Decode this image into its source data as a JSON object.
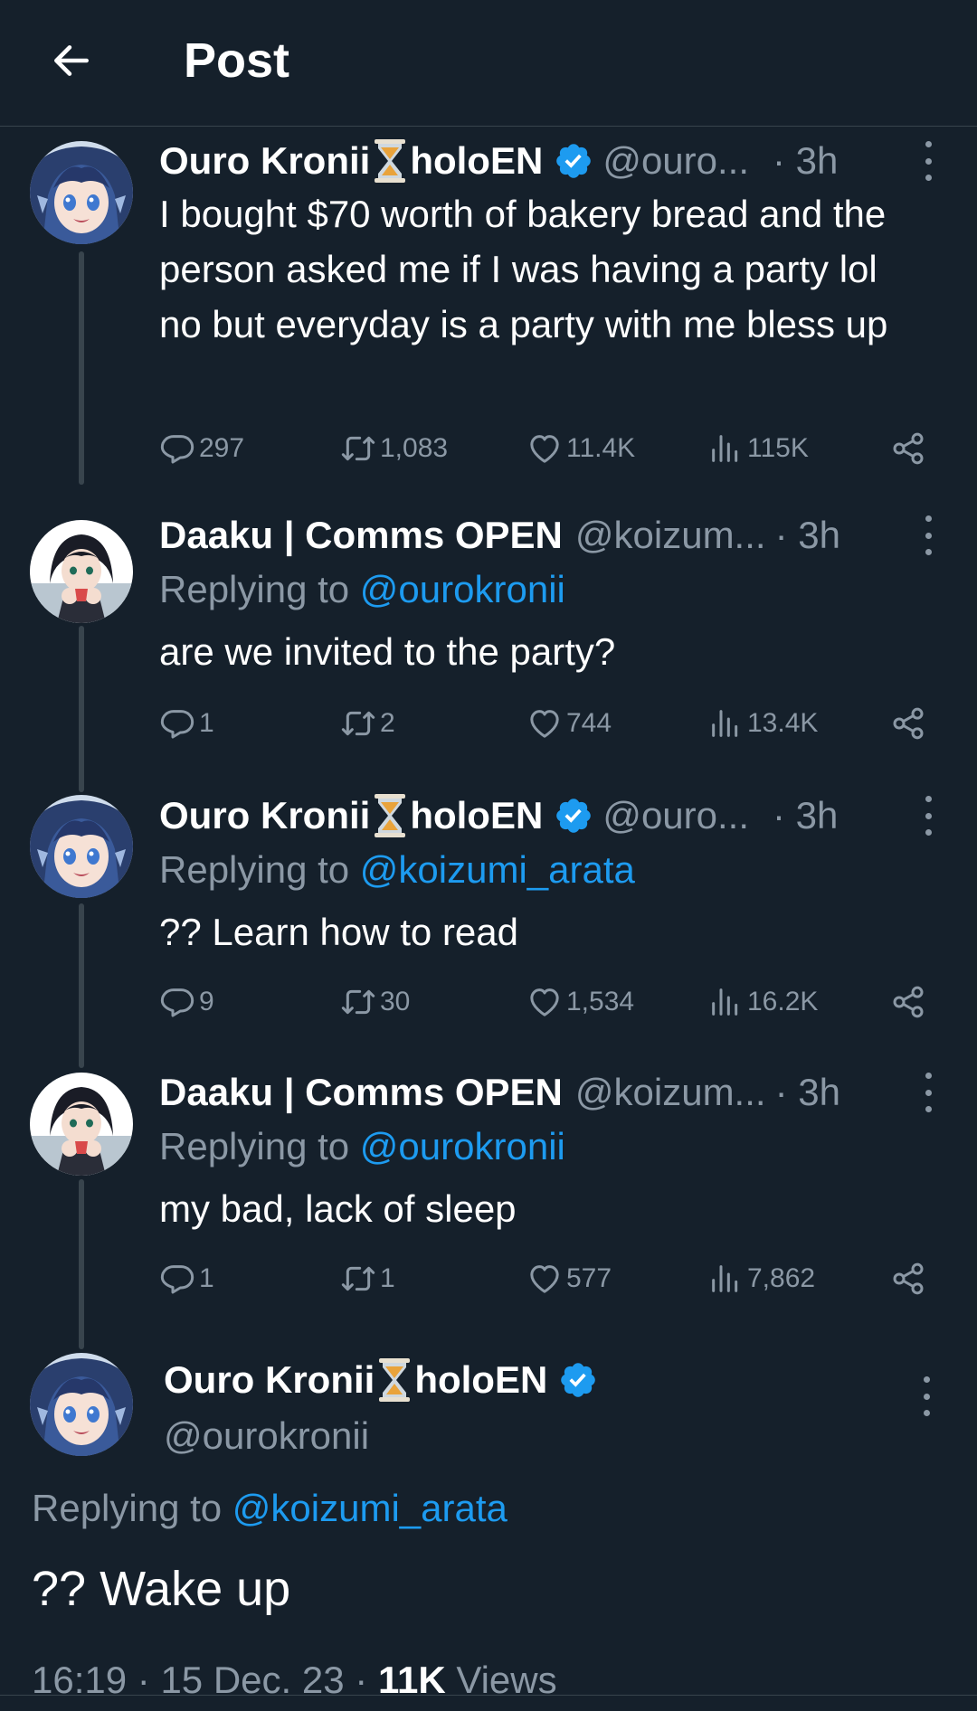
{
  "header": {
    "title": "Post"
  },
  "thread": [
    {
      "name_first": "Ouro Kronii",
      "name_second": "holoEN",
      "verified": true,
      "handle": "@ouro...",
      "time": "· 3h",
      "replying_prefix": "",
      "replying_to": "",
      "text": "I bought $70 worth of bakery bread and the person asked me if I was having a party lol no but everyday is a party with me bless up",
      "replies": "297",
      "reposts": "1,083",
      "likes": "11.4K",
      "views": "115K"
    },
    {
      "name_first": "Daaku | Comms OPEN",
      "name_second": "",
      "verified": false,
      "handle": "@koizum...",
      "time": "· 3h",
      "replying_prefix": "Replying to ",
      "replying_to": "@ourokronii",
      "text": "are we invited to the party?",
      "replies": "1",
      "reposts": "2",
      "likes": "744",
      "views": "13.4K"
    },
    {
      "name_first": "Ouro Kronii",
      "name_second": "holoEN",
      "verified": true,
      "handle": "@ouro...",
      "time": "· 3h",
      "replying_prefix": "Replying to ",
      "replying_to": "@koizumi_arata",
      "text": "?? Learn how to read",
      "replies": "9",
      "reposts": "30",
      "likes": "1,534",
      "views": "16.2K"
    },
    {
      "name_first": "Daaku | Comms OPEN",
      "name_second": "",
      "verified": false,
      "handle": "@koizum...",
      "time": "· 3h",
      "replying_prefix": "Replying to ",
      "replying_to": "@ourokronii",
      "text": "my bad, lack of sleep",
      "replies": "1",
      "reposts": "1",
      "likes": "577",
      "views": "7,862"
    }
  ],
  "main_post": {
    "name_first": "Ouro Kronii",
    "name_second": "holoEN",
    "handle": "@ourokronii",
    "replying_prefix": "Replying to ",
    "replying_to": "@koizumi_arata",
    "text": "?? Wake up",
    "time": "16:19",
    "separator": "·",
    "date": "15 Dec. 23",
    "views_count": "11K",
    "views_label": "Views"
  },
  "icons": {
    "back": "arrow-left-icon",
    "hourglass": "hourglass-icon",
    "verified": "verified-badge-icon",
    "reply": "reply-icon",
    "repost": "repost-icon",
    "like": "heart-icon",
    "views": "views-icon",
    "share": "share-icon",
    "more": "more-icon"
  },
  "colors": {
    "background": "#15202b",
    "divider": "#38444d",
    "text_primary": "#ffffff",
    "text_secondary": "#8b98a5",
    "accent": "#1d9bf0"
  }
}
